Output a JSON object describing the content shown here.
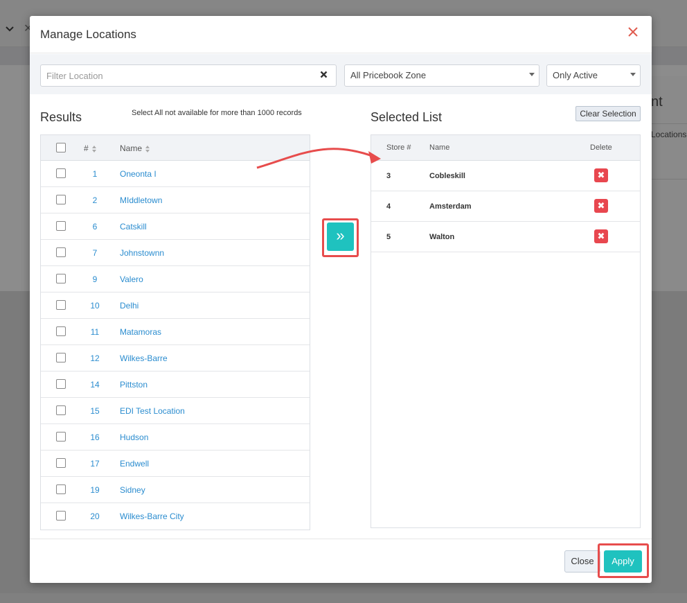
{
  "background": {
    "card_title": "nt",
    "card_link": "Locations"
  },
  "modal": {
    "title": "Manage Locations",
    "close_glyph": "✕"
  },
  "filters": {
    "search_placeholder": "Filter Location",
    "clear_glyph": "✖",
    "zone_select": "All Pricebook Zone",
    "status_select": "Only Active"
  },
  "results": {
    "title": "Results",
    "note": "Select All not available for more than 1000 records",
    "headers": {
      "num": "#",
      "name": "Name"
    },
    "rows": [
      {
        "num": "1",
        "name": "Oneonta I"
      },
      {
        "num": "2",
        "name": "MIddletown"
      },
      {
        "num": "6",
        "name": "Catskill"
      },
      {
        "num": "7",
        "name": "Johnstownn"
      },
      {
        "num": "9",
        "name": "Valero"
      },
      {
        "num": "10",
        "name": "Delhi"
      },
      {
        "num": "11",
        "name": "Matamoras"
      },
      {
        "num": "12",
        "name": "Wilkes-Barre"
      },
      {
        "num": "14",
        "name": "Pittston"
      },
      {
        "num": "15",
        "name": "EDI Test Location"
      },
      {
        "num": "16",
        "name": "Hudson"
      },
      {
        "num": "17",
        "name": "Endwell"
      },
      {
        "num": "19",
        "name": "Sidney"
      },
      {
        "num": "20",
        "name": "Wilkes-Barre City"
      }
    ]
  },
  "move_button": {
    "glyph": "»"
  },
  "selected": {
    "title": "Selected List",
    "clear_label": "Clear Selection",
    "headers": {
      "store": "Store #",
      "name": "Name",
      "delete": "Delete"
    },
    "rows": [
      {
        "store": "3",
        "name": "Cobleskill"
      },
      {
        "store": "4",
        "name": "Amsterdam"
      },
      {
        "store": "5",
        "name": "Walton"
      }
    ],
    "delete_glyph": "✖"
  },
  "footer": {
    "close_label": "Close",
    "apply_label": "Apply"
  },
  "colors": {
    "accent": "#1fc2bf",
    "highlight": "#e74c4c",
    "delete": "#e8474f",
    "link": "#2a8ccf"
  }
}
